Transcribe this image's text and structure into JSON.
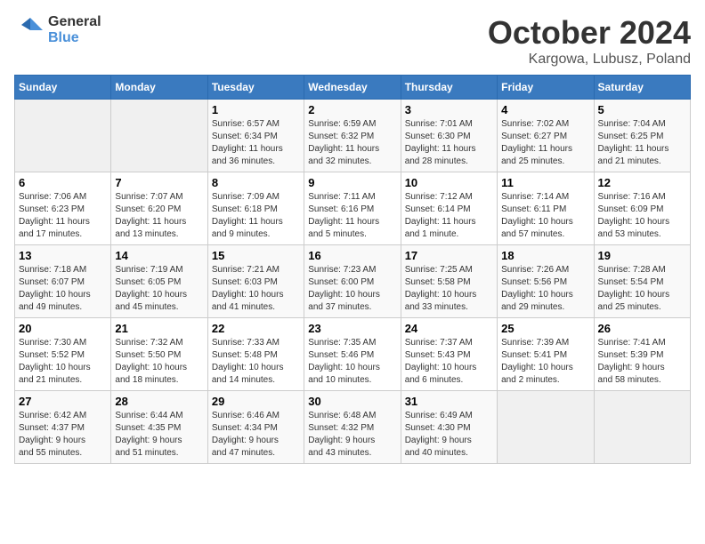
{
  "logo": {
    "line1": "General",
    "line2": "Blue"
  },
  "title": "October 2024",
  "location": "Kargowa, Lubusz, Poland",
  "weekdays": [
    "Sunday",
    "Monday",
    "Tuesday",
    "Wednesday",
    "Thursday",
    "Friday",
    "Saturday"
  ],
  "weeks": [
    [
      {
        "day": "",
        "info": ""
      },
      {
        "day": "",
        "info": ""
      },
      {
        "day": "1",
        "info": "Sunrise: 6:57 AM\nSunset: 6:34 PM\nDaylight: 11 hours\nand 36 minutes."
      },
      {
        "day": "2",
        "info": "Sunrise: 6:59 AM\nSunset: 6:32 PM\nDaylight: 11 hours\nand 32 minutes."
      },
      {
        "day": "3",
        "info": "Sunrise: 7:01 AM\nSunset: 6:30 PM\nDaylight: 11 hours\nand 28 minutes."
      },
      {
        "day": "4",
        "info": "Sunrise: 7:02 AM\nSunset: 6:27 PM\nDaylight: 11 hours\nand 25 minutes."
      },
      {
        "day": "5",
        "info": "Sunrise: 7:04 AM\nSunset: 6:25 PM\nDaylight: 11 hours\nand 21 minutes."
      }
    ],
    [
      {
        "day": "6",
        "info": "Sunrise: 7:06 AM\nSunset: 6:23 PM\nDaylight: 11 hours\nand 17 minutes."
      },
      {
        "day": "7",
        "info": "Sunrise: 7:07 AM\nSunset: 6:20 PM\nDaylight: 11 hours\nand 13 minutes."
      },
      {
        "day": "8",
        "info": "Sunrise: 7:09 AM\nSunset: 6:18 PM\nDaylight: 11 hours\nand 9 minutes."
      },
      {
        "day": "9",
        "info": "Sunrise: 7:11 AM\nSunset: 6:16 PM\nDaylight: 11 hours\nand 5 minutes."
      },
      {
        "day": "10",
        "info": "Sunrise: 7:12 AM\nSunset: 6:14 PM\nDaylight: 11 hours\nand 1 minute."
      },
      {
        "day": "11",
        "info": "Sunrise: 7:14 AM\nSunset: 6:11 PM\nDaylight: 10 hours\nand 57 minutes."
      },
      {
        "day": "12",
        "info": "Sunrise: 7:16 AM\nSunset: 6:09 PM\nDaylight: 10 hours\nand 53 minutes."
      }
    ],
    [
      {
        "day": "13",
        "info": "Sunrise: 7:18 AM\nSunset: 6:07 PM\nDaylight: 10 hours\nand 49 minutes."
      },
      {
        "day": "14",
        "info": "Sunrise: 7:19 AM\nSunset: 6:05 PM\nDaylight: 10 hours\nand 45 minutes."
      },
      {
        "day": "15",
        "info": "Sunrise: 7:21 AM\nSunset: 6:03 PM\nDaylight: 10 hours\nand 41 minutes."
      },
      {
        "day": "16",
        "info": "Sunrise: 7:23 AM\nSunset: 6:00 PM\nDaylight: 10 hours\nand 37 minutes."
      },
      {
        "day": "17",
        "info": "Sunrise: 7:25 AM\nSunset: 5:58 PM\nDaylight: 10 hours\nand 33 minutes."
      },
      {
        "day": "18",
        "info": "Sunrise: 7:26 AM\nSunset: 5:56 PM\nDaylight: 10 hours\nand 29 minutes."
      },
      {
        "day": "19",
        "info": "Sunrise: 7:28 AM\nSunset: 5:54 PM\nDaylight: 10 hours\nand 25 minutes."
      }
    ],
    [
      {
        "day": "20",
        "info": "Sunrise: 7:30 AM\nSunset: 5:52 PM\nDaylight: 10 hours\nand 21 minutes."
      },
      {
        "day": "21",
        "info": "Sunrise: 7:32 AM\nSunset: 5:50 PM\nDaylight: 10 hours\nand 18 minutes."
      },
      {
        "day": "22",
        "info": "Sunrise: 7:33 AM\nSunset: 5:48 PM\nDaylight: 10 hours\nand 14 minutes."
      },
      {
        "day": "23",
        "info": "Sunrise: 7:35 AM\nSunset: 5:46 PM\nDaylight: 10 hours\nand 10 minutes."
      },
      {
        "day": "24",
        "info": "Sunrise: 7:37 AM\nSunset: 5:43 PM\nDaylight: 10 hours\nand 6 minutes."
      },
      {
        "day": "25",
        "info": "Sunrise: 7:39 AM\nSunset: 5:41 PM\nDaylight: 10 hours\nand 2 minutes."
      },
      {
        "day": "26",
        "info": "Sunrise: 7:41 AM\nSunset: 5:39 PM\nDaylight: 9 hours\nand 58 minutes."
      }
    ],
    [
      {
        "day": "27",
        "info": "Sunrise: 6:42 AM\nSunset: 4:37 PM\nDaylight: 9 hours\nand 55 minutes."
      },
      {
        "day": "28",
        "info": "Sunrise: 6:44 AM\nSunset: 4:35 PM\nDaylight: 9 hours\nand 51 minutes."
      },
      {
        "day": "29",
        "info": "Sunrise: 6:46 AM\nSunset: 4:34 PM\nDaylight: 9 hours\nand 47 minutes."
      },
      {
        "day": "30",
        "info": "Sunrise: 6:48 AM\nSunset: 4:32 PM\nDaylight: 9 hours\nand 43 minutes."
      },
      {
        "day": "31",
        "info": "Sunrise: 6:49 AM\nSunset: 4:30 PM\nDaylight: 9 hours\nand 40 minutes."
      },
      {
        "day": "",
        "info": ""
      },
      {
        "day": "",
        "info": ""
      }
    ]
  ]
}
